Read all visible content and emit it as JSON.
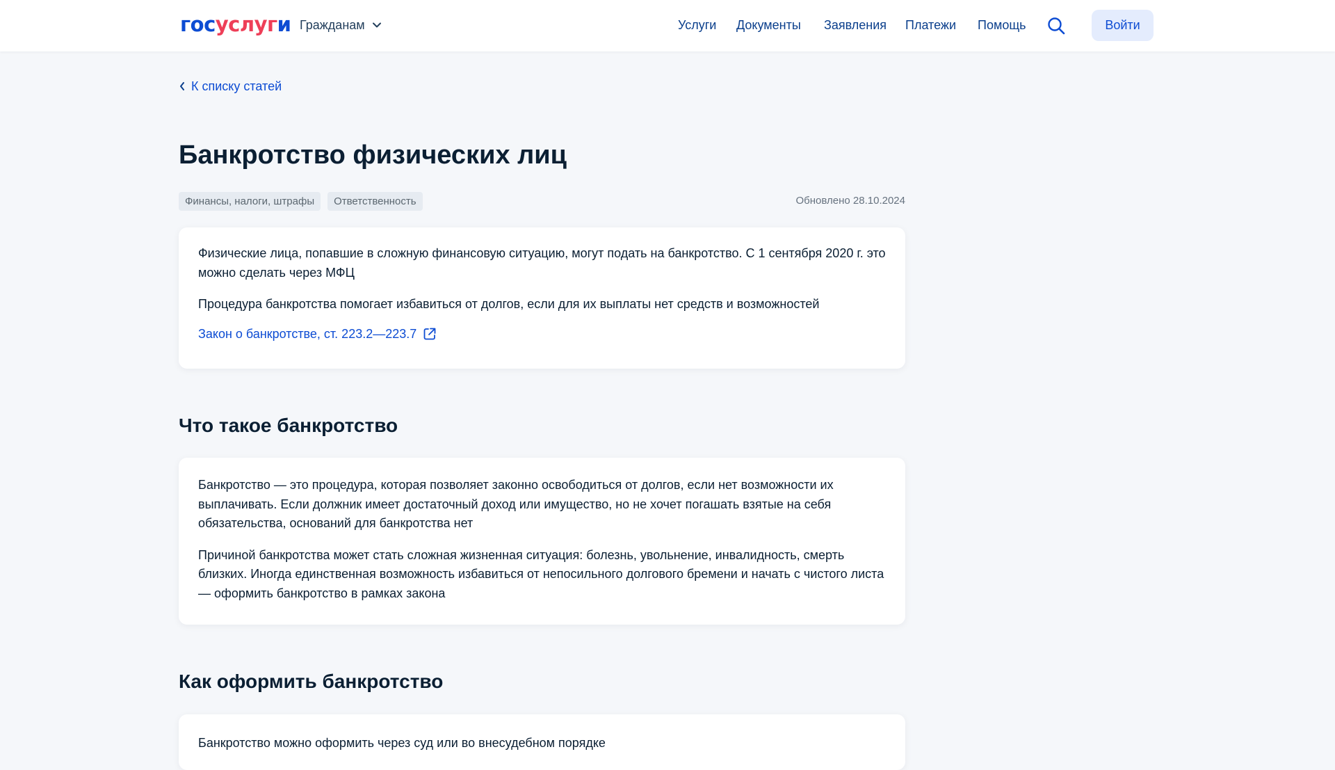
{
  "header": {
    "logo": {
      "part1": "гос",
      "part2": "услуг",
      "part3": "и"
    },
    "audience": "Гражданам",
    "nav": [
      "Услуги",
      "Документы",
      "Заявления",
      "Платежи",
      "Помощь"
    ],
    "login": "Войти"
  },
  "back_link": "К списку статей",
  "title": "Банкротство физических лиц",
  "tags": [
    "Финансы, налоги, штрафы",
    "Ответственность"
  ],
  "updated": "Обновлено 28.10.2024",
  "intro": {
    "p1": "Физические лица, попавшие в сложную финансовую ситуацию, могут подать на банкротство. С 1 сентября 2020 г. это можно сделать через МФЦ",
    "p2": "Процедура банкротства помогает избавиться от долгов, если для их выплаты нет средств и возможностей",
    "link": "Закон о банкротстве, ст. 223.2—223.7"
  },
  "section_what": {
    "heading": "Что такое банкротство",
    "p1": "Банкротство — это процедура, которая позволяет законно освободиться от долгов, если нет возможности их выплачивать. Если должник имеет достаточный доход или имущество, но не хочет погашать взятые на себя обязательства, оснований для банкротства нет",
    "p2": "Причиной банкротства может стать сложная жизненная ситуация: болезнь, увольнение, инвалидность, смерть близких. Иногда единственная возможность избавиться от непосильного долгового бремени и начать с чистого листа — оформить банкротство в рамках закона"
  },
  "section_how": {
    "heading": "Как оформить банкротство",
    "p1": "Банкротство можно оформить через суд или во внесудебном порядке"
  },
  "colors": {
    "brand_blue": "#0d4cd3",
    "brand_red": "#ee3f58",
    "background": "#f5f7fa",
    "login_bg": "#e4ecfd"
  }
}
